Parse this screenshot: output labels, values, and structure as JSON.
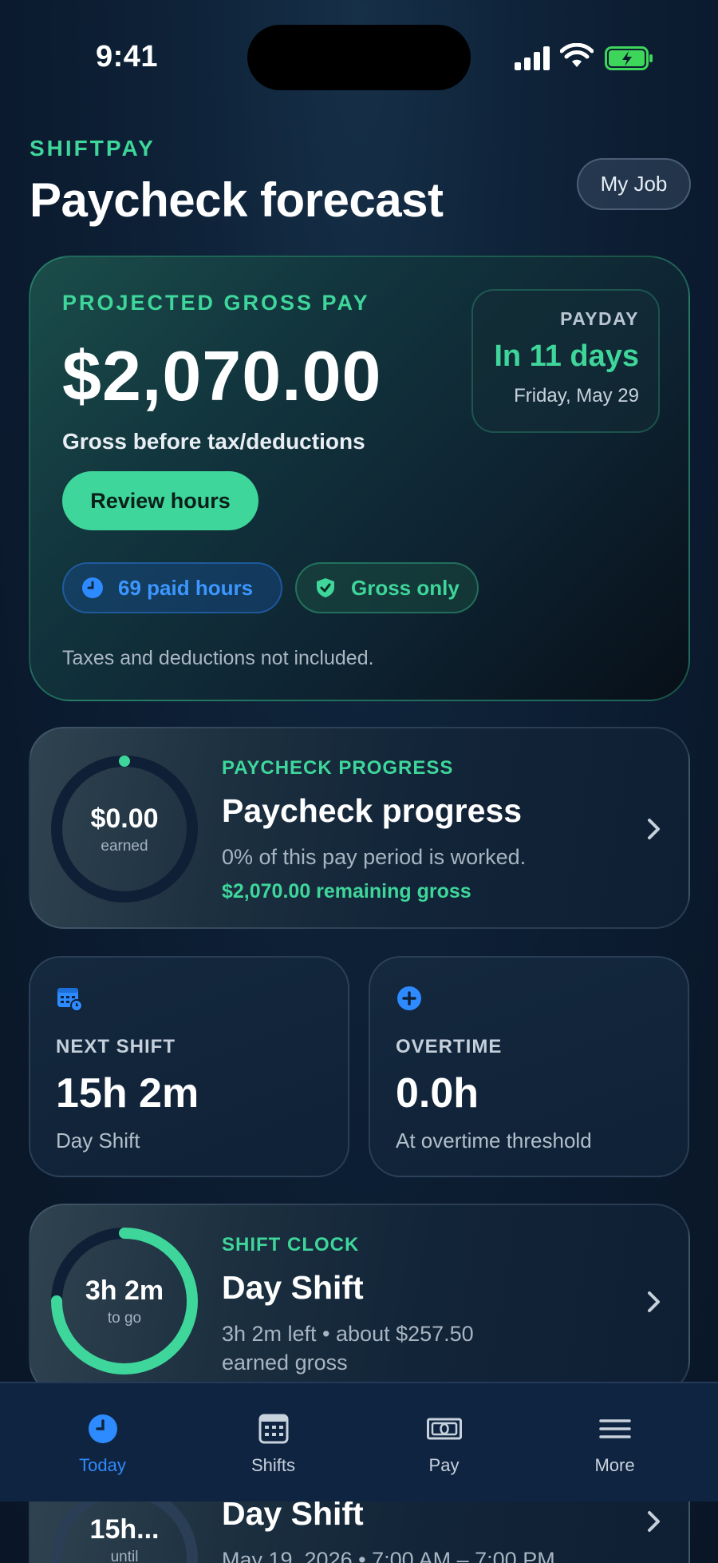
{
  "status": {
    "time": "9:41"
  },
  "header": {
    "app_name": "SHIFTPAY",
    "title": "Paycheck forecast",
    "my_job": "My Job"
  },
  "hero": {
    "label": "PROJECTED GROSS PAY",
    "amount": "$2,070.00",
    "sub": "Gross before tax/deductions",
    "review_button": "Review hours",
    "payday_label": "PAYDAY",
    "payday_in": "In 11 days",
    "payday_date": "Friday, May 29",
    "pill_hours": "69 paid hours",
    "pill_gross": "Gross only",
    "note": "Taxes and deductions not included."
  },
  "progress": {
    "ring_amount": "$0.00",
    "ring_label": "earned",
    "ring_fraction": 0,
    "eyebrow": "PAYCHECK PROGRESS",
    "title": "Paycheck progress",
    "line": "0% of this pay period is worked.",
    "remaining": "$2,070.00 remaining gross"
  },
  "next_shift": {
    "label": "NEXT SHIFT",
    "value": "15h 2m",
    "sub": "Day Shift"
  },
  "overtime": {
    "label": "OVERTIME",
    "value": "0.0h",
    "sub": "At overtime threshold"
  },
  "shift_clock": {
    "ring_value": "3h 2m",
    "ring_label": "to go",
    "ring_fraction": 0.75,
    "eyebrow": "SHIFT CLOCK",
    "title": "Day Shift",
    "line1": "3h 2m left • about $257.50",
    "line2": "earned gross"
  },
  "upcoming": {
    "ring_value": "15h...",
    "ring_label": "until",
    "title": "Day Shift",
    "line": "May 19, 2026 • 7:00 AM – 7:00 PM"
  },
  "tabs": [
    {
      "label": "Today",
      "icon": "clock-icon",
      "active": true
    },
    {
      "label": "Shifts",
      "icon": "calendar-icon",
      "active": false
    },
    {
      "label": "Pay",
      "icon": "banknote-icon",
      "active": false
    },
    {
      "label": "More",
      "icon": "menu-icon",
      "active": false
    }
  ],
  "colors": {
    "accent_green": "#3ed69a",
    "accent_blue": "#2e8bff",
    "background": "#0b1a2e"
  }
}
